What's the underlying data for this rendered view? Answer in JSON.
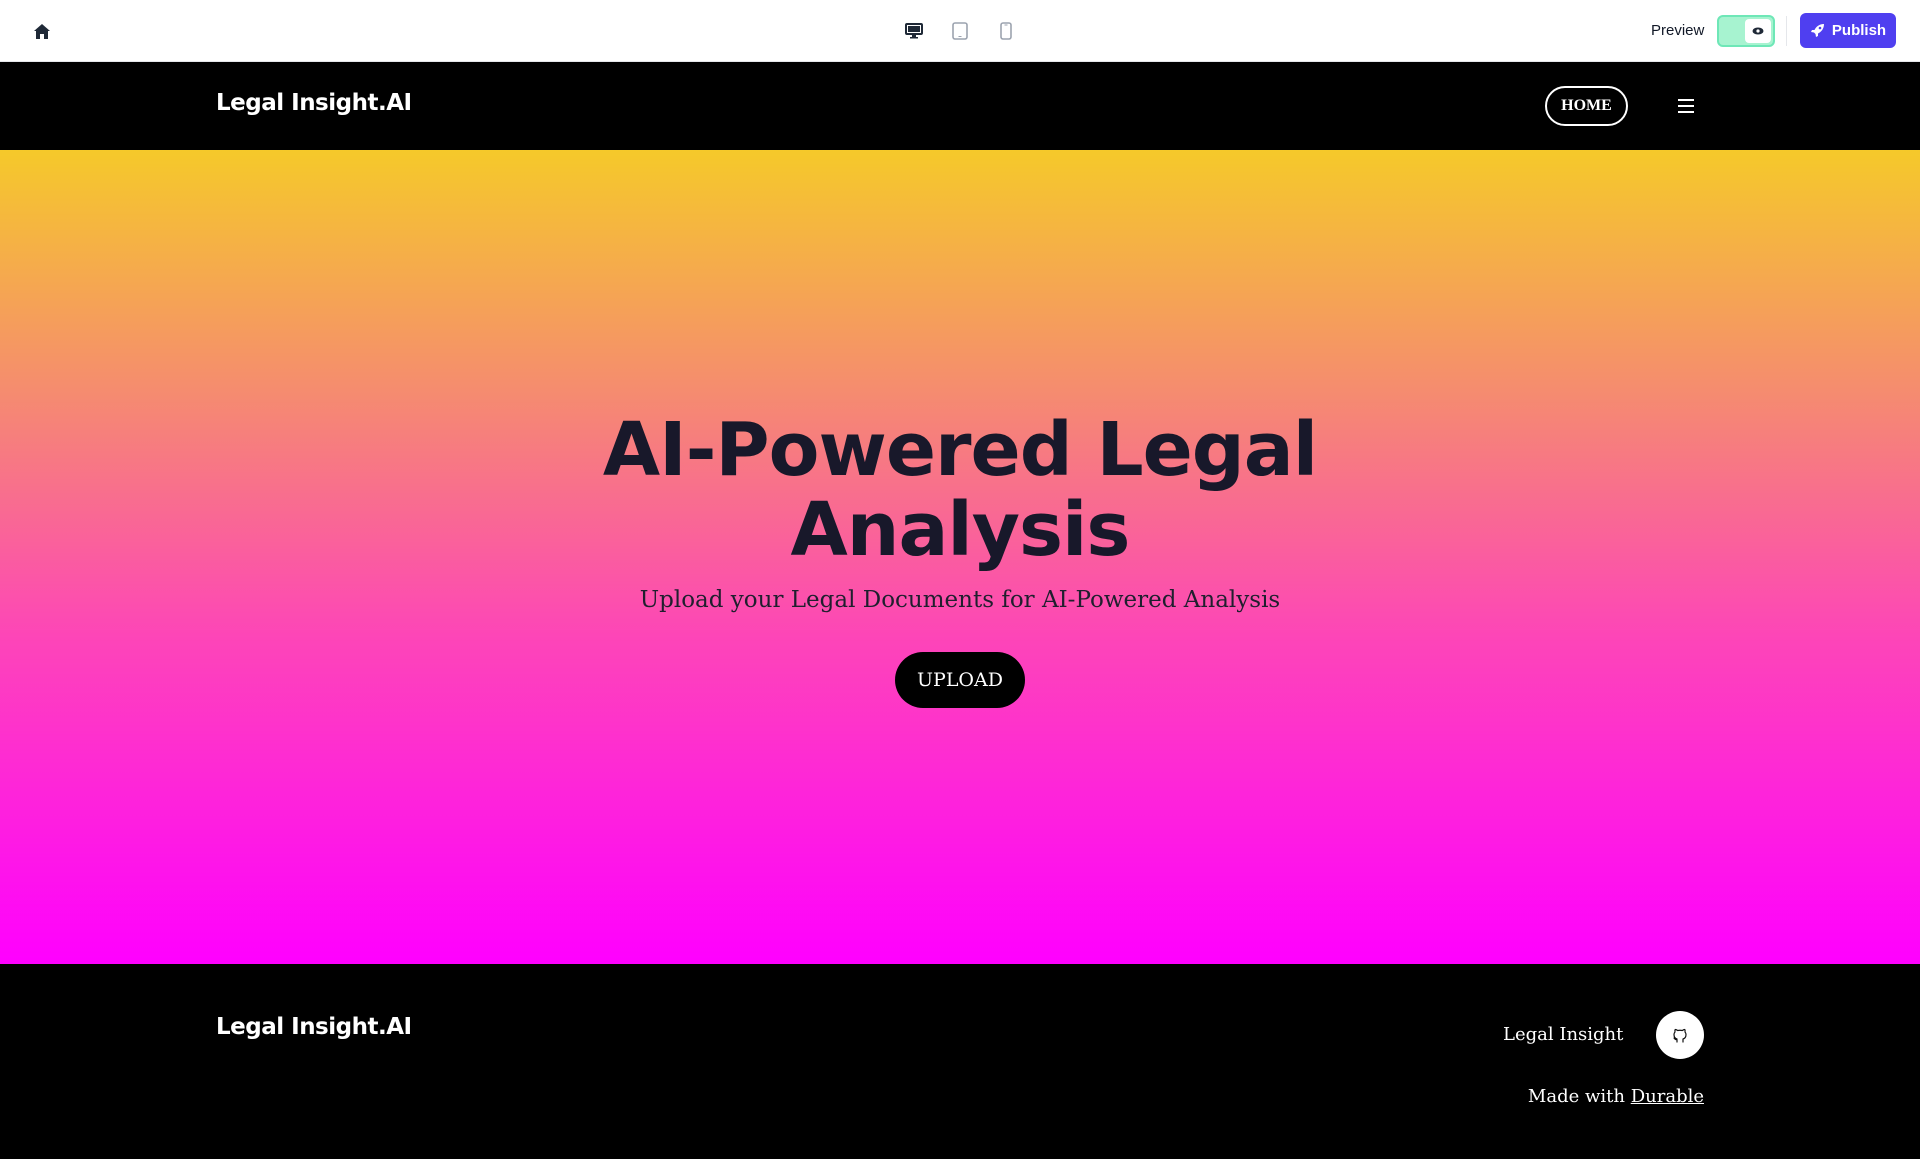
{
  "toolbar": {
    "preview_label": "Preview",
    "publish_label": "Publish",
    "accent_color": "#4f3ff0",
    "toggle_color": "#a7f3d0",
    "devices": [
      "desktop-icon",
      "tablet-icon",
      "mobile-icon"
    ]
  },
  "header": {
    "brand": "Legal Insight.AI",
    "nav_home": "HOME"
  },
  "hero": {
    "title": "AI-Powered Legal Analysis",
    "subtitle": "Upload your Legal Documents for AI-Powered Analysis",
    "cta_label": "UPLOAD",
    "gradient": [
      "#f5c92a",
      "#f58b70",
      "#fd45b8",
      "#ff00ff"
    ]
  },
  "footer": {
    "brand": "Legal Insight.AI",
    "name": "Legal Insight",
    "made_with_prefix": "Made with",
    "made_with_link": "Durable"
  }
}
